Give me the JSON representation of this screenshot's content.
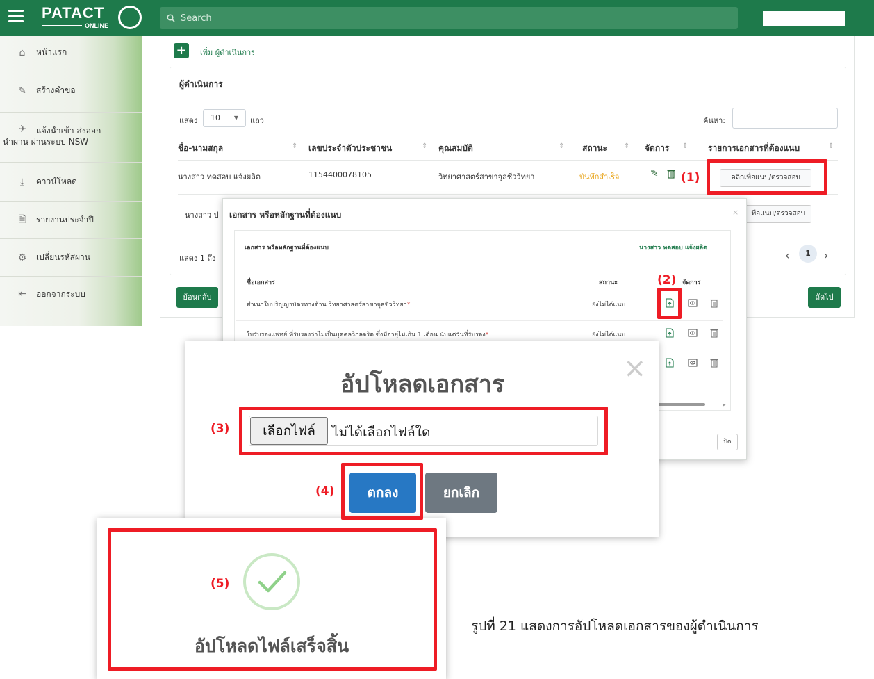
{
  "app": {
    "logo_text": "PATACT",
    "logo_sub": "ONLINE",
    "search_placeholder": "Search"
  },
  "sidebar": {
    "items": [
      {
        "label": "หน้าแรก",
        "icon": "home-icon"
      },
      {
        "label": "สร้างคำขอ",
        "icon": "pencil-icon"
      },
      {
        "label_line1": "แจ้งนำเข้า ส่งออก",
        "label_line2": "นำผ่าน ผ่านระบบ NSW",
        "icon": "plane-icon"
      },
      {
        "label": "ดาวน์โหลด",
        "icon": "download-icon"
      },
      {
        "label": "รายงานประจำปี",
        "icon": "file-icon"
      },
      {
        "label": "เปลี่ยนรหัสผ่าน",
        "icon": "gears-icon"
      },
      {
        "label": "ออกจากระบบ",
        "icon": "sign-out-icon"
      }
    ]
  },
  "main": {
    "add_label": "เพิ่ม ผู้ดำเนินการ",
    "card_title": "ผู้ดำเนินการ",
    "show_label": "แสดง",
    "page_size": "10",
    "rows_label": "แถว",
    "search_label": "ค้นหา:",
    "columns": [
      "ชื่อ-นามสกุล",
      "เลขประจำตัวประชาชน",
      "คุณสมบัติ",
      "สถานะ",
      "จัดการ",
      "รายการเอกสารที่ต้องแนบ"
    ],
    "rows": [
      {
        "name": "นางสาว ทดสอบ แจ้งผลิต",
        "id": "1154400078105",
        "qualification": "วิทยาศาสตร์สาขาจุลชีววิทยา",
        "status": "บันทึกสำเร็จ",
        "doc_button": "คลิกเพื่อแนบ/ตรวจสอบ"
      },
      {
        "name_partial": "นางสาว ป",
        "doc_button_partial": "พื่อแนบ/ตรวจสอบ"
      }
    ],
    "showing_text": "แสดง 1 ถึง",
    "current_page": "1",
    "back_button": "ย้อนกลับ",
    "next_button": "ถัดไป"
  },
  "doc_modal": {
    "title": "เอกสาร หรือหลักฐานที่ต้องแนบ",
    "inner_title": "เอกสาร หรือหลักฐานที่ต้องแนบ",
    "person": "นางสาว ทดสอบ แจ้งผลิต",
    "col_name": "ชื่อเอกสาร",
    "col_status": "สถานะ",
    "col_manage": "จัดการ",
    "docs": [
      {
        "name": "สำเนาใบปริญญาบัตรทางด้าน วิทยาศาสตร์สาขาจุลชีววิทยา",
        "required": "*",
        "status": "ยังไม่ได้แนบ"
      },
      {
        "name": "ใบรับรองแพทย์ ที่รับรองว่าไม่เป็นบุคคลวิกลจริต ซึ่งมีอายุไม่เกิน 1 เดือน นับแต่วันที่รับรอง",
        "required": "*",
        "status": "ยังไม่ได้แนบ"
      }
    ],
    "close_button": "ปิด"
  },
  "upload_modal": {
    "title": "อัปโหลดเอกสาร",
    "choose_file": "เลือกไฟล์",
    "no_file": "ไม่ได้เลือกไฟล์ใด",
    "ok": "ตกลง",
    "cancel": "ยกเลิก"
  },
  "success_dialog": {
    "message": "อัปโหลดไฟล์เสร็จสิ้น"
  },
  "annotations": [
    "(1)",
    "(2)",
    "(3)",
    "(4)",
    "(5)"
  ],
  "caption": "รูปที่ 21 แสดงการอัปโหลดเอกสารของผู้ดำเนินการ",
  "colors": {
    "brand_green": "#1e7a4b",
    "highlight_red": "#ee1c25",
    "status_saved": "#e8a317",
    "ok_blue": "#2778c4",
    "cancel_gray": "#6e7881"
  }
}
